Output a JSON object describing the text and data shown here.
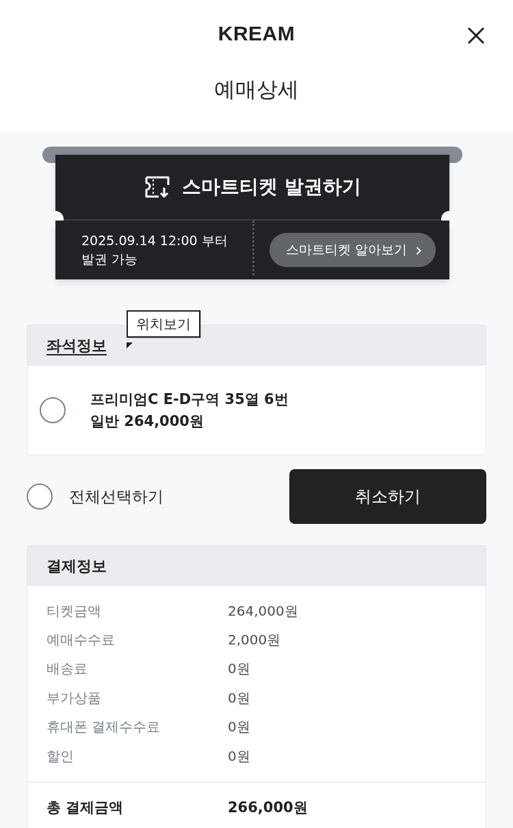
{
  "header": {
    "brand": "KREAM",
    "title": "예매상세"
  },
  "ticket": {
    "title": "스마트티켓 발권하기",
    "issue_note": [
      "2025.09.14 12:00 부터",
      "발권 가능"
    ],
    "info_button": "스마트티켓 알아보기",
    "info_button_chevron": "›"
  },
  "seat_info": {
    "title": "좌석정보",
    "tooltip": "위치보기",
    "seats": [
      {
        "lines": [
          "프리미엄C E-D구역 35열 6번",
          "일반 264,000원"
        ],
        "checked": false
      }
    ]
  },
  "select_all": {
    "label": "전체선택하기",
    "checked": false
  },
  "cancel_button": "취소하기",
  "payment": {
    "title": "결제정보",
    "rows": [
      {
        "label": "티켓금액",
        "value": "264,000원"
      },
      {
        "label": "예매수수료",
        "value": "2,000원"
      },
      {
        "label": "배송료",
        "value": "0원"
      },
      {
        "label": "부가상품",
        "value": "0원"
      },
      {
        "label": "휴대폰 결제수수료",
        "value": "0원"
      },
      {
        "label": "할인",
        "value": "0원"
      }
    ],
    "total": {
      "label": "총 결제금액",
      "value": "266,000원"
    }
  }
}
